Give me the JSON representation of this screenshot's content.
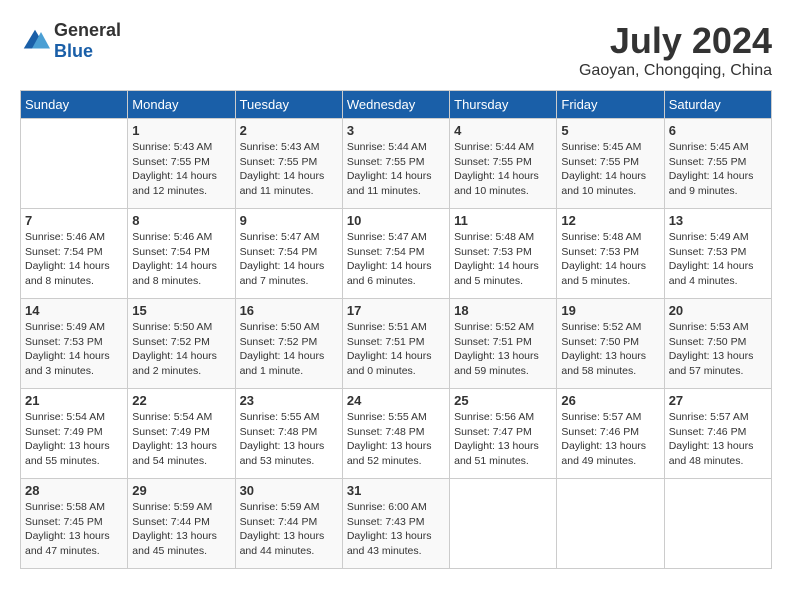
{
  "logo": {
    "text_general": "General",
    "text_blue": "Blue"
  },
  "title": "July 2024",
  "subtitle": "Gaoyan, Chongqing, China",
  "days_of_week": [
    "Sunday",
    "Monday",
    "Tuesday",
    "Wednesday",
    "Thursday",
    "Friday",
    "Saturday"
  ],
  "weeks": [
    [
      {
        "day": "",
        "info": ""
      },
      {
        "day": "1",
        "info": "Sunrise: 5:43 AM\nSunset: 7:55 PM\nDaylight: 14 hours\nand 12 minutes."
      },
      {
        "day": "2",
        "info": "Sunrise: 5:43 AM\nSunset: 7:55 PM\nDaylight: 14 hours\nand 11 minutes."
      },
      {
        "day": "3",
        "info": "Sunrise: 5:44 AM\nSunset: 7:55 PM\nDaylight: 14 hours\nand 11 minutes."
      },
      {
        "day": "4",
        "info": "Sunrise: 5:44 AM\nSunset: 7:55 PM\nDaylight: 14 hours\nand 10 minutes."
      },
      {
        "day": "5",
        "info": "Sunrise: 5:45 AM\nSunset: 7:55 PM\nDaylight: 14 hours\nand 10 minutes."
      },
      {
        "day": "6",
        "info": "Sunrise: 5:45 AM\nSunset: 7:55 PM\nDaylight: 14 hours\nand 9 minutes."
      }
    ],
    [
      {
        "day": "7",
        "info": "Sunrise: 5:46 AM\nSunset: 7:54 PM\nDaylight: 14 hours\nand 8 minutes."
      },
      {
        "day": "8",
        "info": "Sunrise: 5:46 AM\nSunset: 7:54 PM\nDaylight: 14 hours\nand 8 minutes."
      },
      {
        "day": "9",
        "info": "Sunrise: 5:47 AM\nSunset: 7:54 PM\nDaylight: 14 hours\nand 7 minutes."
      },
      {
        "day": "10",
        "info": "Sunrise: 5:47 AM\nSunset: 7:54 PM\nDaylight: 14 hours\nand 6 minutes."
      },
      {
        "day": "11",
        "info": "Sunrise: 5:48 AM\nSunset: 7:53 PM\nDaylight: 14 hours\nand 5 minutes."
      },
      {
        "day": "12",
        "info": "Sunrise: 5:48 AM\nSunset: 7:53 PM\nDaylight: 14 hours\nand 5 minutes."
      },
      {
        "day": "13",
        "info": "Sunrise: 5:49 AM\nSunset: 7:53 PM\nDaylight: 14 hours\nand 4 minutes."
      }
    ],
    [
      {
        "day": "14",
        "info": "Sunrise: 5:49 AM\nSunset: 7:53 PM\nDaylight: 14 hours\nand 3 minutes."
      },
      {
        "day": "15",
        "info": "Sunrise: 5:50 AM\nSunset: 7:52 PM\nDaylight: 14 hours\nand 2 minutes."
      },
      {
        "day": "16",
        "info": "Sunrise: 5:50 AM\nSunset: 7:52 PM\nDaylight: 14 hours\nand 1 minute."
      },
      {
        "day": "17",
        "info": "Sunrise: 5:51 AM\nSunset: 7:51 PM\nDaylight: 14 hours\nand 0 minutes."
      },
      {
        "day": "18",
        "info": "Sunrise: 5:52 AM\nSunset: 7:51 PM\nDaylight: 13 hours\nand 59 minutes."
      },
      {
        "day": "19",
        "info": "Sunrise: 5:52 AM\nSunset: 7:50 PM\nDaylight: 13 hours\nand 58 minutes."
      },
      {
        "day": "20",
        "info": "Sunrise: 5:53 AM\nSunset: 7:50 PM\nDaylight: 13 hours\nand 57 minutes."
      }
    ],
    [
      {
        "day": "21",
        "info": "Sunrise: 5:54 AM\nSunset: 7:49 PM\nDaylight: 13 hours\nand 55 minutes."
      },
      {
        "day": "22",
        "info": "Sunrise: 5:54 AM\nSunset: 7:49 PM\nDaylight: 13 hours\nand 54 minutes."
      },
      {
        "day": "23",
        "info": "Sunrise: 5:55 AM\nSunset: 7:48 PM\nDaylight: 13 hours\nand 53 minutes."
      },
      {
        "day": "24",
        "info": "Sunrise: 5:55 AM\nSunset: 7:48 PM\nDaylight: 13 hours\nand 52 minutes."
      },
      {
        "day": "25",
        "info": "Sunrise: 5:56 AM\nSunset: 7:47 PM\nDaylight: 13 hours\nand 51 minutes."
      },
      {
        "day": "26",
        "info": "Sunrise: 5:57 AM\nSunset: 7:46 PM\nDaylight: 13 hours\nand 49 minutes."
      },
      {
        "day": "27",
        "info": "Sunrise: 5:57 AM\nSunset: 7:46 PM\nDaylight: 13 hours\nand 48 minutes."
      }
    ],
    [
      {
        "day": "28",
        "info": "Sunrise: 5:58 AM\nSunset: 7:45 PM\nDaylight: 13 hours\nand 47 minutes."
      },
      {
        "day": "29",
        "info": "Sunrise: 5:59 AM\nSunset: 7:44 PM\nDaylight: 13 hours\nand 45 minutes."
      },
      {
        "day": "30",
        "info": "Sunrise: 5:59 AM\nSunset: 7:44 PM\nDaylight: 13 hours\nand 44 minutes."
      },
      {
        "day": "31",
        "info": "Sunrise: 6:00 AM\nSunset: 7:43 PM\nDaylight: 13 hours\nand 43 minutes."
      },
      {
        "day": "",
        "info": ""
      },
      {
        "day": "",
        "info": ""
      },
      {
        "day": "",
        "info": ""
      }
    ]
  ]
}
